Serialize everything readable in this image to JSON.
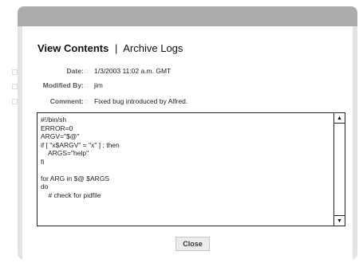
{
  "tabs": {
    "active": "View Contents",
    "separator": "|",
    "archive_link": "Archive Logs"
  },
  "meta": {
    "date_label": "Date:",
    "date_value": "1/3/2003 11:02 a.m. GMT",
    "modified_label": "Modified By:",
    "modified_value": "jim",
    "comment_label": "Comment:",
    "comment_value": "Fixed bug introduced by Alfred."
  },
  "label_glyph": "□",
  "file_contents": "#!/bin/sh\nERROR=0\nARGV=\"$@\"\nif [ \"x$ARGV\" = \"x\" ] ; then\n    ARGS=\"help\"\nfi\n\nfor ARG in $@ $ARGS\ndo\n    # check for pidfile",
  "scrollbar": {
    "up_icon": "▲",
    "down_icon": "▼"
  },
  "close_button": "Close"
}
